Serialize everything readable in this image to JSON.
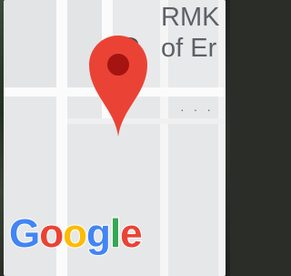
{
  "map": {
    "place_label_lines": [
      "RMK",
      "of Er"
    ],
    "pin": {
      "icon": "map-pin-icon",
      "color": "#ea4335",
      "center_color": "#a51410"
    },
    "attribution": {
      "letters": [
        {
          "char": "G",
          "color": "#4285f4"
        },
        {
          "char": "o",
          "color": "#ea4335"
        },
        {
          "char": "o",
          "color": "#fbbc05"
        },
        {
          "char": "g",
          "color": "#4285f4"
        },
        {
          "char": "l",
          "color": "#34a853"
        },
        {
          "char": "e",
          "color": "#ea4335"
        }
      ]
    }
  }
}
